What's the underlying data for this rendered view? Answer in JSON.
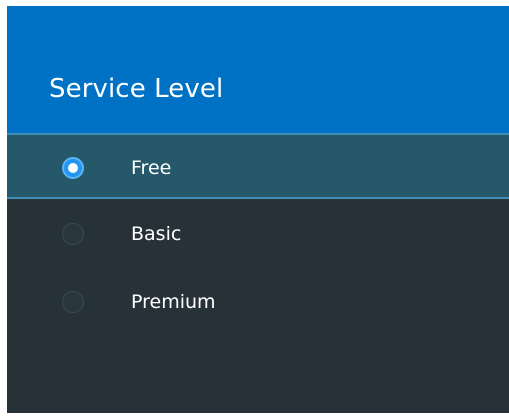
{
  "dialog": {
    "title": "Service Level",
    "options": [
      {
        "label": "Free",
        "selected": true
      },
      {
        "label": "Basic",
        "selected": false
      },
      {
        "label": "Premium",
        "selected": false
      }
    ]
  },
  "colors": {
    "header": "#0072c6",
    "background": "#263238",
    "selected_row": "#255869",
    "radio_accent": "#2196f3"
  }
}
